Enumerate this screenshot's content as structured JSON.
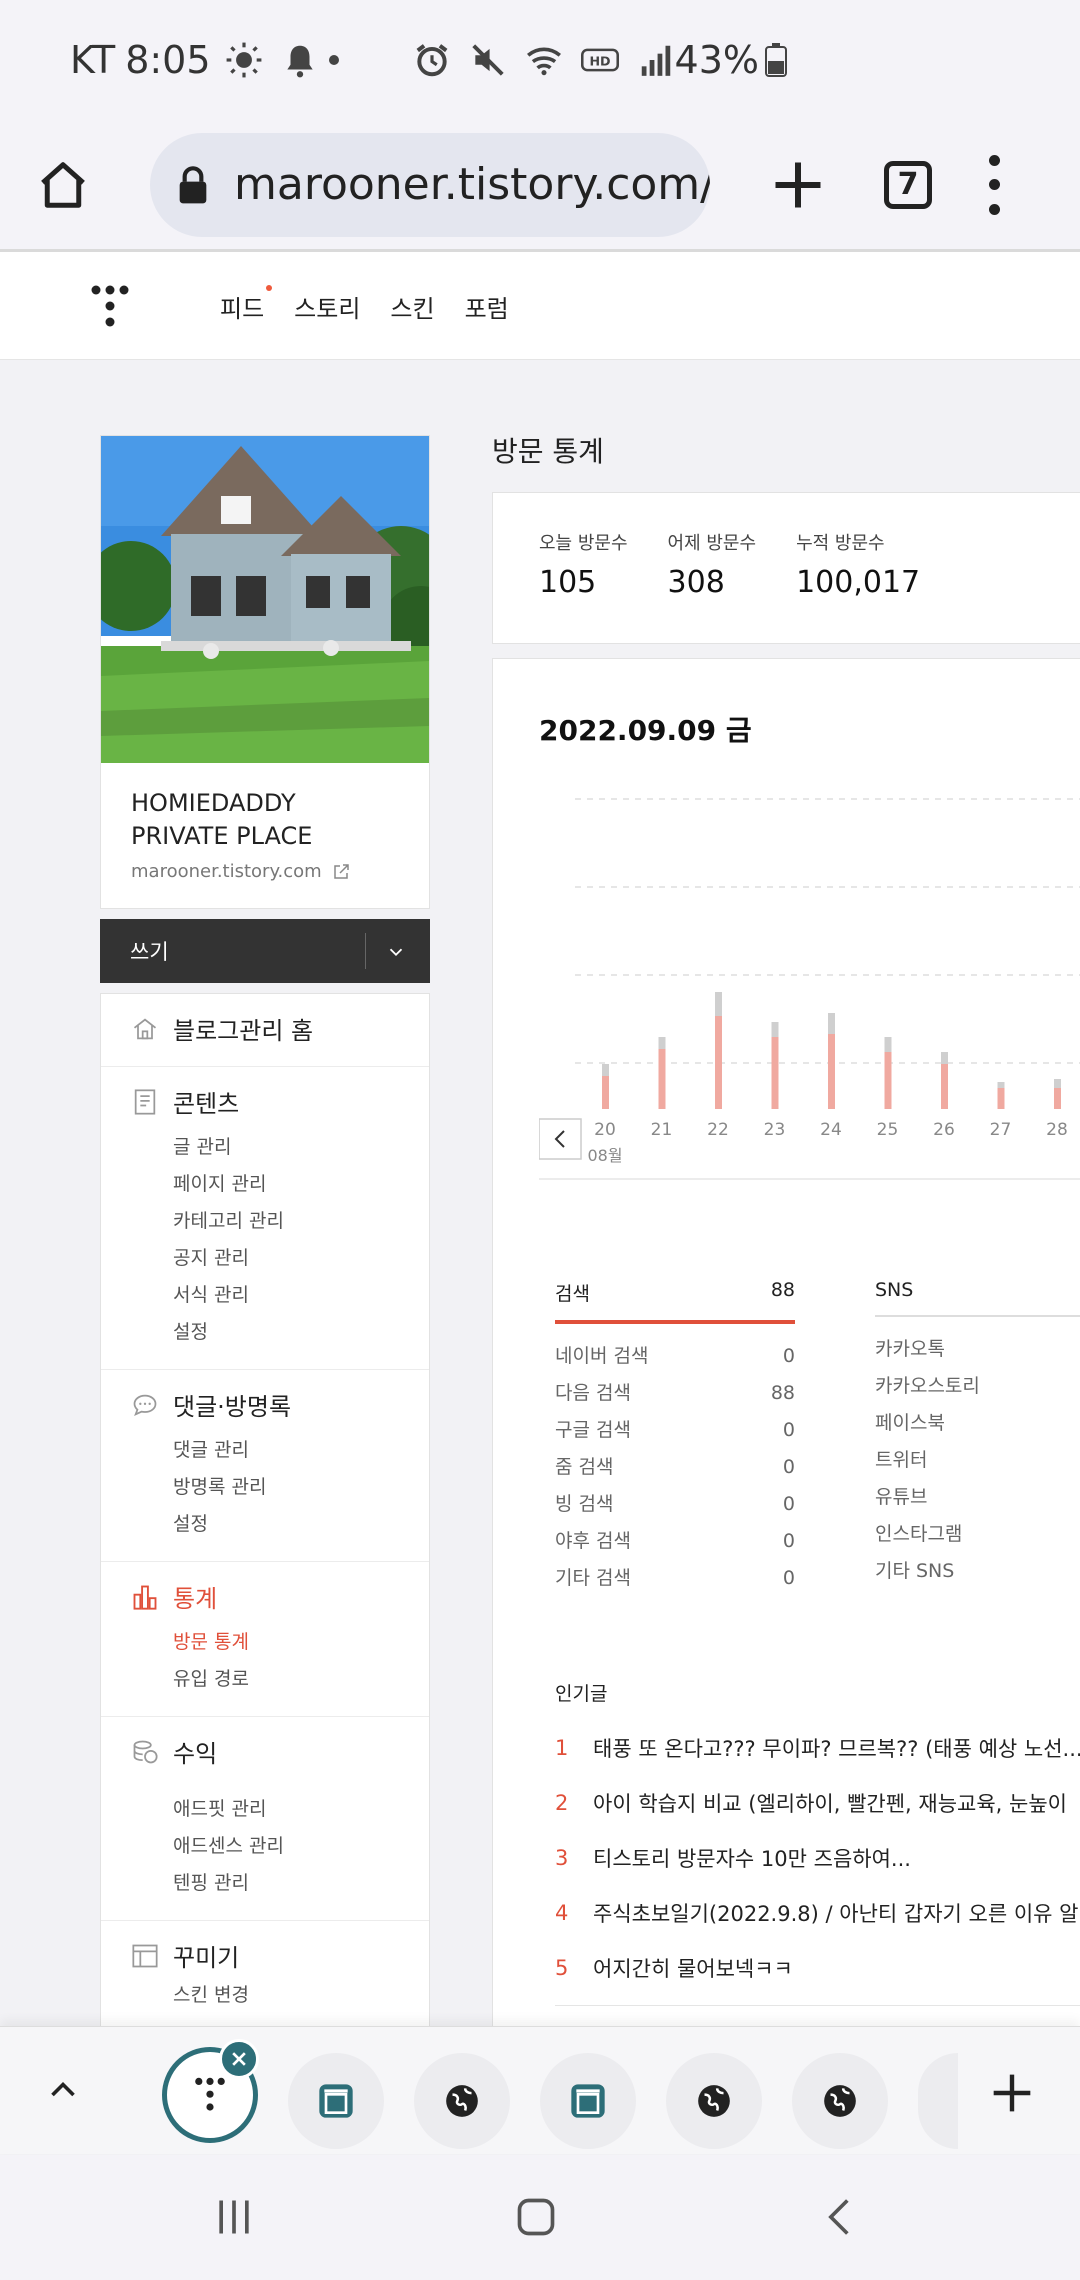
{
  "status_bar": {
    "carrier": "KT",
    "time": "8:05",
    "battery": "43%"
  },
  "browser": {
    "url": "marooner.tistory.com/",
    "tab_count": "7"
  },
  "site_nav": {
    "items": [
      "피드",
      "스토리",
      "스킨",
      "포럼"
    ]
  },
  "profile": {
    "blog_name": "HOMIEDADDY PRIVATE PLACE",
    "blog_url": "marooner.tistory.com"
  },
  "write_button": {
    "label": "쓰기"
  },
  "menu": {
    "home": "블로그관리 홈",
    "content": {
      "title": "콘텐츠",
      "items": [
        "글 관리",
        "페이지 관리",
        "카테고리 관리",
        "공지 관리",
        "서식 관리",
        "설정"
      ]
    },
    "comments": {
      "title": "댓글·방명록",
      "items": [
        "댓글 관리",
        "방명록 관리",
        "설정"
      ]
    },
    "stats": {
      "title": "통계",
      "items": [
        "방문 통계",
        "유입 경로"
      ]
    },
    "revenue": {
      "title": "수익",
      "items": [
        "애드핏 관리",
        "애드센스 관리",
        "텐핑 관리"
      ]
    },
    "design": {
      "title": "꾸미기",
      "items": [
        "스킨 변경"
      ]
    }
  },
  "main": {
    "title": "방문 통계",
    "visits": {
      "today_label": "오늘 방문수",
      "today": "105",
      "yesterday_label": "어제 방문수",
      "yesterday": "308",
      "total_label": "누적 방문수",
      "total": "100,017"
    },
    "chart_date": "2022.09.09 금",
    "search": {
      "title": "검색",
      "total": "88",
      "rows": [
        {
          "label": "네이버 검색",
          "value": "0"
        },
        {
          "label": "다음 검색",
          "value": "88"
        },
        {
          "label": "구글 검색",
          "value": "0"
        },
        {
          "label": "줌 검색",
          "value": "0"
        },
        {
          "label": "빙 검색",
          "value": "0"
        },
        {
          "label": "야후 검색",
          "value": "0"
        },
        {
          "label": "기타 검색",
          "value": "0"
        }
      ]
    },
    "sns": {
      "title": "SNS",
      "rows": [
        "카카오톡",
        "카카오스토리",
        "페이스북",
        "트위터",
        "유튜브",
        "인스타그램",
        "기타 SNS"
      ]
    },
    "popular": {
      "title": "인기글",
      "posts": [
        {
          "rank": "1",
          "title": "태풍 또 온다고??? 무이파? 므르복?? (태풍 예상 노선..."
        },
        {
          "rank": "2",
          "title": "아이 학습지 비교 (엘리하이, 빨간펜, 재능교육, 눈높이"
        },
        {
          "rank": "3",
          "title": "티스토리 방문자수 10만 즈음하여..."
        },
        {
          "rank": "4",
          "title": "주식초보일기(2022.9.8) / 아난티 갑자기 오른 이유 알"
        },
        {
          "rank": "5",
          "title": "어지간히 물어보넥ㅋㅋ"
        }
      ]
    }
  },
  "chart_data": {
    "type": "bar",
    "categories": [
      "20",
      "21",
      "22",
      "23",
      "24",
      "25",
      "26",
      "27",
      "28"
    ],
    "month_label": "08월",
    "series": [
      {
        "values": [
          22,
          40,
          62,
          48,
          50,
          38,
          30,
          14,
          14
        ]
      },
      {
        "values": [
          8,
          8,
          16,
          10,
          14,
          10,
          8,
          4,
          6
        ]
      }
    ],
    "grid": true,
    "colors": {
      "main": "#f0a9a0",
      "secondary": "#cfcfcf"
    }
  },
  "colors": {
    "accent": "#e0503a",
    "tab_accent": "#2d6e78"
  }
}
